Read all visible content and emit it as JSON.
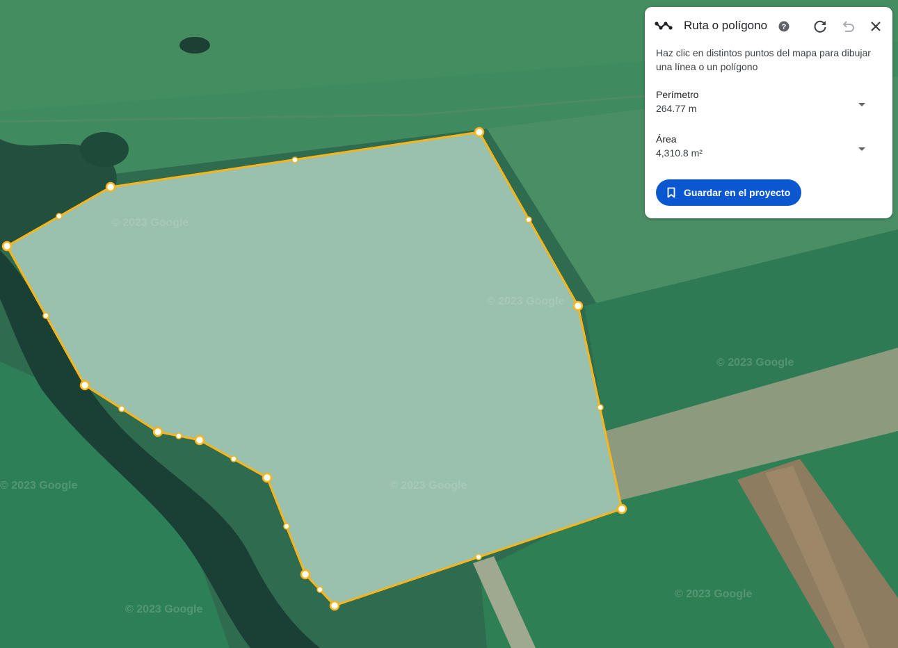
{
  "panel": {
    "title": "Ruta o polígono",
    "instructions": "Haz clic en distintos puntos del mapa para dibujar una línea o un polígono",
    "perimeter_label": "Perímetro",
    "perimeter_value": "264.77 m",
    "area_label": "Área",
    "area_value": "4,310.8 m²",
    "save_label": "Guardar en el proyecto",
    "icons": {
      "path": "path-icon",
      "help": "help-icon",
      "redo": "redo-icon",
      "undo": "undo-icon",
      "close": "close-icon",
      "dropdown": "arrow-drop-down-icon",
      "bookmark": "bookmark-icon"
    }
  },
  "map": {
    "watermark": "© 2023 Google"
  },
  "colors": {
    "accent": "#0b57d0",
    "polygon_stroke": "#f9b51a",
    "polygon_fill": "#cfe4dc",
    "vertex_fill": "#ffffff"
  }
}
